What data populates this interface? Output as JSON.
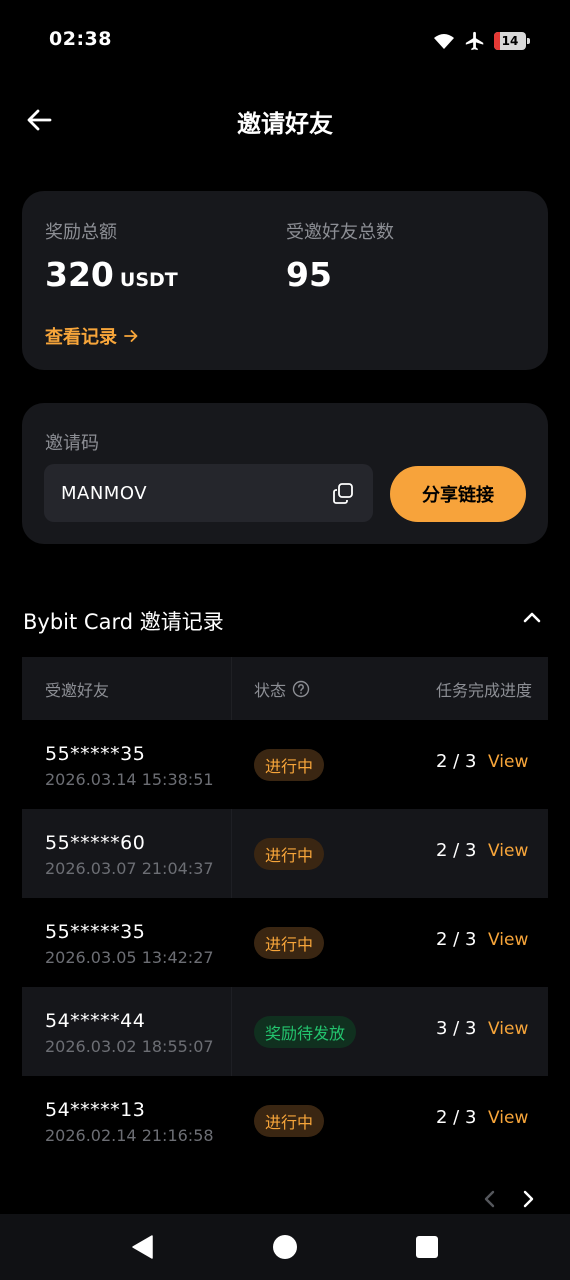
{
  "status_bar": {
    "time": "02:38",
    "battery": "14"
  },
  "header": {
    "title": "邀请好友"
  },
  "summary": {
    "reward_label": "奖励总额",
    "reward_value": "320",
    "reward_unit": "USDT",
    "friends_label": "受邀好友总数",
    "friends_value": "95",
    "records_link": "查看记录"
  },
  "invite": {
    "label": "邀请码",
    "code": "MANMOV",
    "share_button": "分享链接"
  },
  "section": {
    "title": "Bybit Card 邀请记录"
  },
  "table": {
    "headers": [
      "受邀好友",
      "状态",
      "任务完成进度"
    ],
    "rows": [
      {
        "uid": "55*****35",
        "time": "2026.03.14 15:38:51",
        "status": "进行中",
        "progress": "2 / 3",
        "action": "View"
      },
      {
        "uid": "55*****60",
        "time": "2026.03.07 21:04:37",
        "status": "进行中",
        "progress": "2 / 3",
        "action": "View"
      },
      {
        "uid": "55*****35",
        "time": "2026.03.05 13:42:27",
        "status": "进行中",
        "progress": "2 / 3",
        "action": "View"
      },
      {
        "uid": "54*****44",
        "time": "2026.03.02 18:55:07",
        "status": "奖励待发放",
        "progress": "3 / 3",
        "action": "View"
      },
      {
        "uid": "54*****13",
        "time": "2026.02.14 21:16:58",
        "status": "进行中",
        "progress": "2 / 3",
        "action": "View"
      }
    ]
  },
  "colors": {
    "accent": "#f7a33b",
    "in_progress": "#f7a53a",
    "pending": "#23c46e",
    "card_bg": "#17181c"
  },
  "icons": {
    "back": "arrow-left-icon",
    "copy": "copy-icon",
    "collapse": "chevron-up-icon",
    "help": "question-circle-icon",
    "prev": "chevron-left-icon",
    "next": "chevron-right-icon"
  }
}
